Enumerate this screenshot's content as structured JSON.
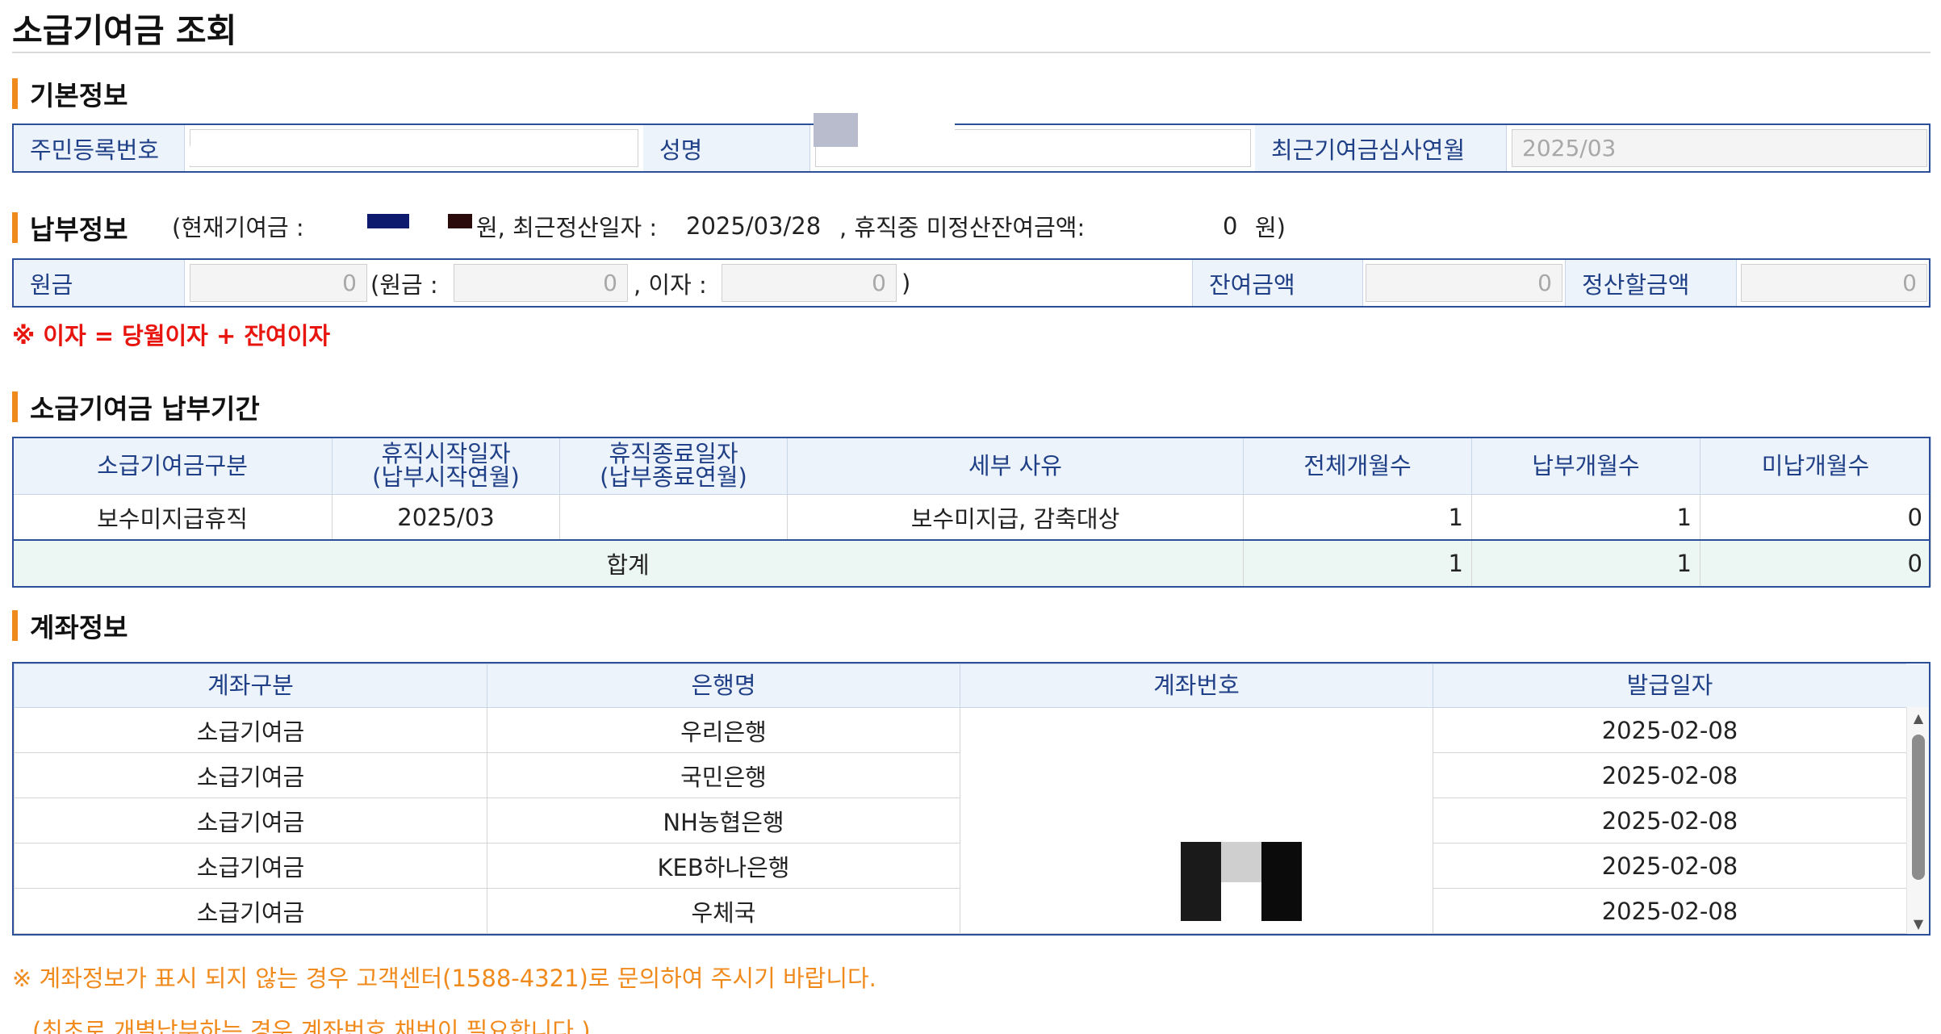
{
  "page": {
    "title": "소급기여금 조회"
  },
  "basic_info": {
    "section_title": "기본정보",
    "resident_no_label": "주민등록번호",
    "resident_no_value": "",
    "name_label": "성명",
    "name_value": "",
    "recent_review_label": "최근기여금심사연월",
    "recent_review_value": "2025/03"
  },
  "payment_info": {
    "section_title": "납부정보",
    "summary_prefix": "(현재기여금 :",
    "summary_won": "원, 최근정산일자 :",
    "summary_date": "2025/03/28",
    "summary_unsettled": ", 휴직중 미정산잔여금액:",
    "summary_unsettled_value": "0",
    "summary_suffix": "원)",
    "principal_label": "원금",
    "principal_value": "0",
    "principal_open": "(원금 :",
    "principal_inner_value": "0",
    "interest_label": ", 이자 :",
    "interest_value": "0",
    "close_paren": ")",
    "balance_label": "잔여금액",
    "balance_value": "0",
    "settle_label": "정산할금액",
    "settle_value": "0",
    "note": "※ 이자 = 당월이자 + 잔여이자"
  },
  "period": {
    "section_title": "소급기여금 납부기간",
    "headers": {
      "type": "소급기여금구분",
      "start_1": "휴직시작일자",
      "start_2": "(납부시작연월)",
      "end_1": "휴직종료일자",
      "end_2": "(납부종료연월)",
      "reason": "세부 사유",
      "total": "전체개월수",
      "paid": "납부개월수",
      "unpaid": "미납개월수"
    },
    "rows": [
      {
        "type": "보수미지급휴직",
        "start": "2025/03",
        "end": "",
        "reason": "보수미지급, 감축대상",
        "total": "1",
        "paid": "1",
        "unpaid": "0"
      }
    ],
    "sum": {
      "label": "합계",
      "total": "1",
      "paid": "1",
      "unpaid": "0"
    }
  },
  "account": {
    "section_title": "계좌정보",
    "headers": {
      "kind": "계좌구분",
      "bank": "은행명",
      "number": "계좌번호",
      "date": "발급일자"
    },
    "rows": [
      {
        "kind": "소급기여금",
        "bank": "우리은행",
        "date": "2025-02-08"
      },
      {
        "kind": "소급기여금",
        "bank": "국민은행",
        "date": "2025-02-08"
      },
      {
        "kind": "소급기여금",
        "bank": "NH농협은행",
        "date": "2025-02-08"
      },
      {
        "kind": "소급기여금",
        "bank": "KEB하나은행",
        "date": "2025-02-08"
      },
      {
        "kind": "소급기여금",
        "bank": "우체국",
        "date": "2025-02-08"
      }
    ],
    "note_1": "※ 계좌정보가 표시 되지 않는 경우 고객센터(1588-4321)로 문의하여 주시기 바랍니다.",
    "note_2": "(최초로 개별납부하는 경우 계좌번호 채번이 필요합니다.)"
  },
  "colors": {
    "accent_orange": "#f08a1c",
    "border_blue": "#2c4f9a",
    "label_bg": "#edf3fb",
    "alert_red": "#e8140e",
    "link_blue": "#1234c8",
    "sum_bg": "#ecf7f3"
  }
}
